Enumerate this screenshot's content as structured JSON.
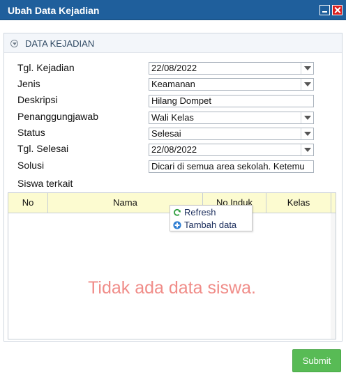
{
  "window": {
    "title": "Ubah Data Kejadian"
  },
  "panel": {
    "title": "DATA KEJADIAN"
  },
  "form": {
    "tgl_kejadian": {
      "label": "Tgl. Kejadian",
      "value": "22/08/2022"
    },
    "jenis": {
      "label": "Jenis",
      "value": "Keamanan"
    },
    "deskripsi": {
      "label": "Deskripsi",
      "value": "Hilang Dompet"
    },
    "penanggungjawab": {
      "label": "Penanggungjawab",
      "value": "Wali Kelas"
    },
    "status": {
      "label": "Status",
      "value": "Selesai"
    },
    "tgl_selesai": {
      "label": "Tgl. Selesai",
      "value": "22/08/2022"
    },
    "solusi": {
      "label": "Solusi",
      "value": "Dicari di semua area sekolah. Ketemu"
    },
    "siswa_terkait": {
      "label": "Siswa terkait"
    }
  },
  "grid": {
    "columns": [
      "No",
      "Nama",
      "No Induk",
      "Kelas"
    ],
    "empty_message": "Tidak ada data siswa."
  },
  "context_menu": {
    "items": [
      {
        "label": "Refresh",
        "icon": "refresh-icon",
        "color": "#2e9e3e"
      },
      {
        "label": "Tambah data",
        "icon": "plus-circle-icon",
        "color": "#2d7dd2"
      }
    ]
  },
  "actions": {
    "submit_label": "Submit",
    "submit_color": "#58bb55"
  },
  "colors": {
    "titlebar": "#1f5f9c",
    "grid_header": "#fcfbd0",
    "empty_text": "#f08c88"
  }
}
